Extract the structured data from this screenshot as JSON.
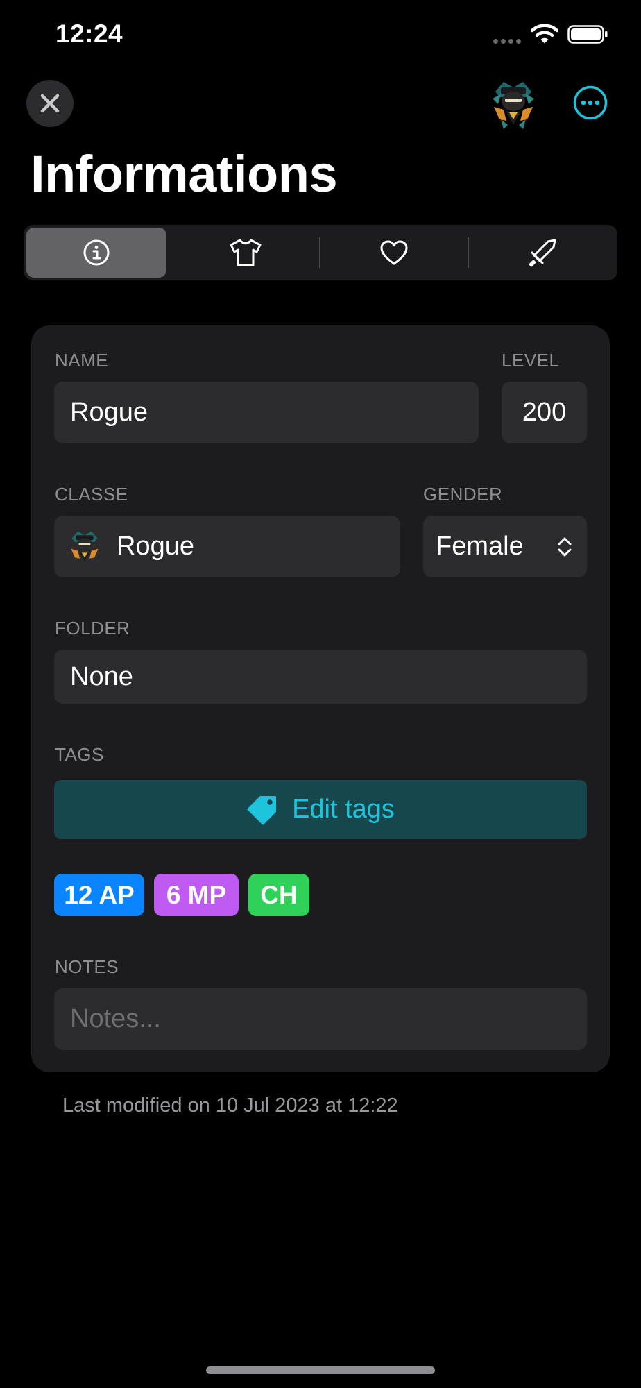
{
  "status_bar": {
    "time": "12:24"
  },
  "nav": {
    "close_icon": "xmark-icon",
    "avatar_icon": "rogue-class-icon",
    "more_icon": "ellipsis-circle-icon"
  },
  "title": "Informations",
  "segments": [
    {
      "icon": "info-circle-icon",
      "selected": true
    },
    {
      "icon": "tshirt-icon",
      "selected": false
    },
    {
      "icon": "heart-icon",
      "selected": false
    },
    {
      "icon": "sword-icon",
      "selected": false
    }
  ],
  "form": {
    "name_label": "NAME",
    "name_value": "Rogue",
    "level_label": "LEVEL",
    "level_value": "200",
    "classe_label": "CLASSE",
    "classe_value": "Rogue",
    "gender_label": "GENDER",
    "gender_value": "Female",
    "folder_label": "FOLDER",
    "folder_value": "None",
    "tags_label": "TAGS",
    "edit_tags_label": "Edit tags",
    "tags": [
      {
        "label": "12 AP",
        "color": "#0a84ff"
      },
      {
        "label": "6 MP",
        "color": "#bf5af2"
      },
      {
        "label": "CH",
        "color": "#30d158"
      }
    ],
    "notes_label": "NOTES",
    "notes_placeholder": "Notes..."
  },
  "footer": "Last modified on 10 Jul 2023 at 12:22",
  "colors": {
    "accent": "#1ec3dc",
    "background": "#000000",
    "card": "#1c1c1e",
    "field": "#2c2c2e"
  }
}
